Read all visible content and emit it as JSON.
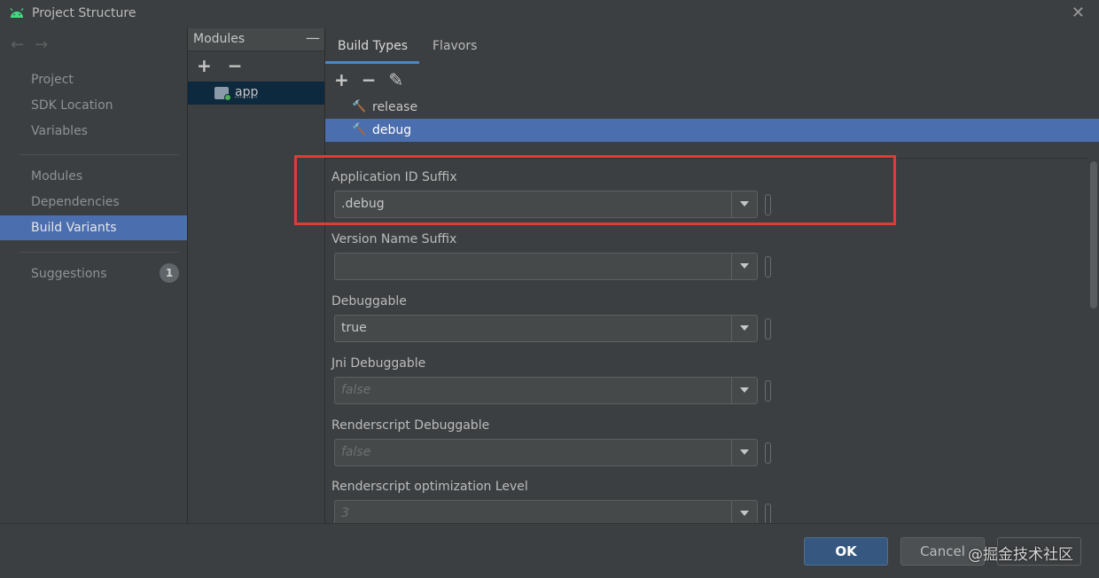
{
  "window": {
    "title": "Project Structure",
    "close_glyph": "✕"
  },
  "nav": {
    "back_glyph": "←",
    "forward_glyph": "→",
    "items_group1": [
      {
        "label": "Project"
      },
      {
        "label": "SDK Location"
      },
      {
        "label": "Variables"
      }
    ],
    "items_group2": [
      {
        "label": "Modules"
      },
      {
        "label": "Dependencies"
      },
      {
        "label": "Build Variants",
        "active": true
      }
    ],
    "suggestions": {
      "label": "Suggestions",
      "count": "1"
    }
  },
  "modules": {
    "header": "Modules",
    "minimize_glyph": "—",
    "add_glyph": "+",
    "remove_glyph": "−",
    "items": [
      {
        "label": "app"
      }
    ]
  },
  "tabs": [
    {
      "label": "Build Types",
      "active": true
    },
    {
      "label": "Flavors"
    }
  ],
  "build_types": {
    "add_glyph": "+",
    "remove_glyph": "−",
    "edit_glyph": "✎",
    "hammer_glyph": "🔨",
    "items": [
      {
        "label": "release"
      },
      {
        "label": "debug",
        "selected": true
      }
    ]
  },
  "fields": [
    {
      "label": "Application ID Suffix",
      "value": ".debug",
      "placeholder": false
    },
    {
      "label": "Version Name Suffix",
      "value": "",
      "placeholder": false
    },
    {
      "label": "Debuggable",
      "value": "true",
      "placeholder": false
    },
    {
      "label": "Jni Debuggable",
      "value": "false",
      "placeholder": true
    },
    {
      "label": "Renderscript Debuggable",
      "value": "false",
      "placeholder": true
    },
    {
      "label": "Renderscript optimization Level",
      "value": "3",
      "placeholder": true
    }
  ],
  "buttons": {
    "ok": "OK",
    "cancel": "Cancel",
    "apply": ""
  },
  "watermark": "@掘金技术社区",
  "colors": {
    "selection": "#4b6eaf",
    "ok_button": "#365880",
    "highlight_box": "#e03a3a"
  }
}
